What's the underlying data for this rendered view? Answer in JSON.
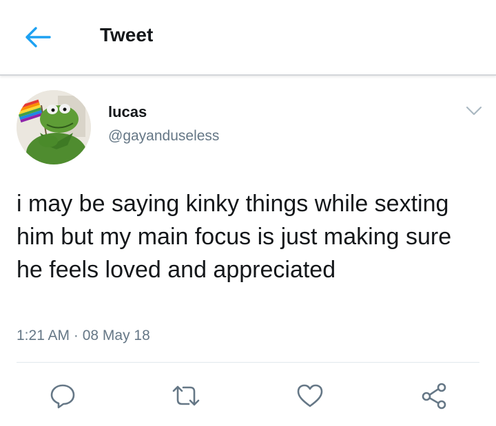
{
  "header": {
    "title": "Tweet",
    "back_icon": "arrow-left-icon"
  },
  "tweet": {
    "author_name": "lucas",
    "author_handle": "@gayanduseless",
    "text": "i may be saying kinky things while sexting him but my main focus is just making sure he feels loved and appreciated",
    "timestamp": "1:21 AM · 08 May 18"
  },
  "colors": {
    "accent": "#1da1f2",
    "secondary_text": "#657786",
    "icon": "#657786"
  },
  "actions": [
    "reply-icon",
    "retweet-icon",
    "like-icon",
    "share-icon"
  ]
}
